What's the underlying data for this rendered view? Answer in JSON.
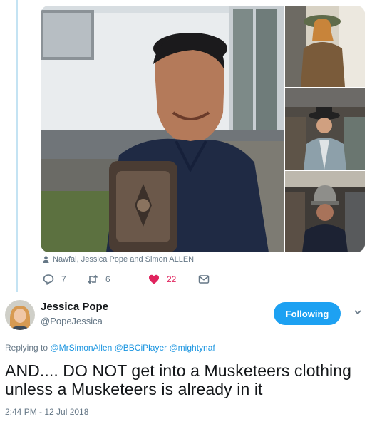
{
  "previous_tweet": {
    "photo_tags": "Nawfal, Jessica Pope and Simon ALLEN",
    "reply_count": "7",
    "retweet_count": "6",
    "like_count": "22",
    "icons": {
      "person": "person-icon",
      "reply": "reply-icon",
      "retweet": "retweet-icon",
      "like": "heart-icon",
      "dm": "envelope-icon"
    },
    "like_color": "#e0245e"
  },
  "tweet": {
    "author_name": "Jessica Pope",
    "author_handle": "@PopeJessica",
    "follow_label": "Following",
    "replying_prefix": "Replying to",
    "mentions": [
      "@MrSimonAllen",
      "@BBCiPlayer",
      "@mightynaf"
    ],
    "text": "AND.... DO NOT get into a Musketeers clothing unless a Musketeers is already in it",
    "timestamp": "2:44 PM - 12 Jul 2018"
  },
  "colors": {
    "accent": "#1da1f2",
    "link": "#1b95e0",
    "muted": "#657786",
    "thread_line": "#c4e3f3"
  }
}
